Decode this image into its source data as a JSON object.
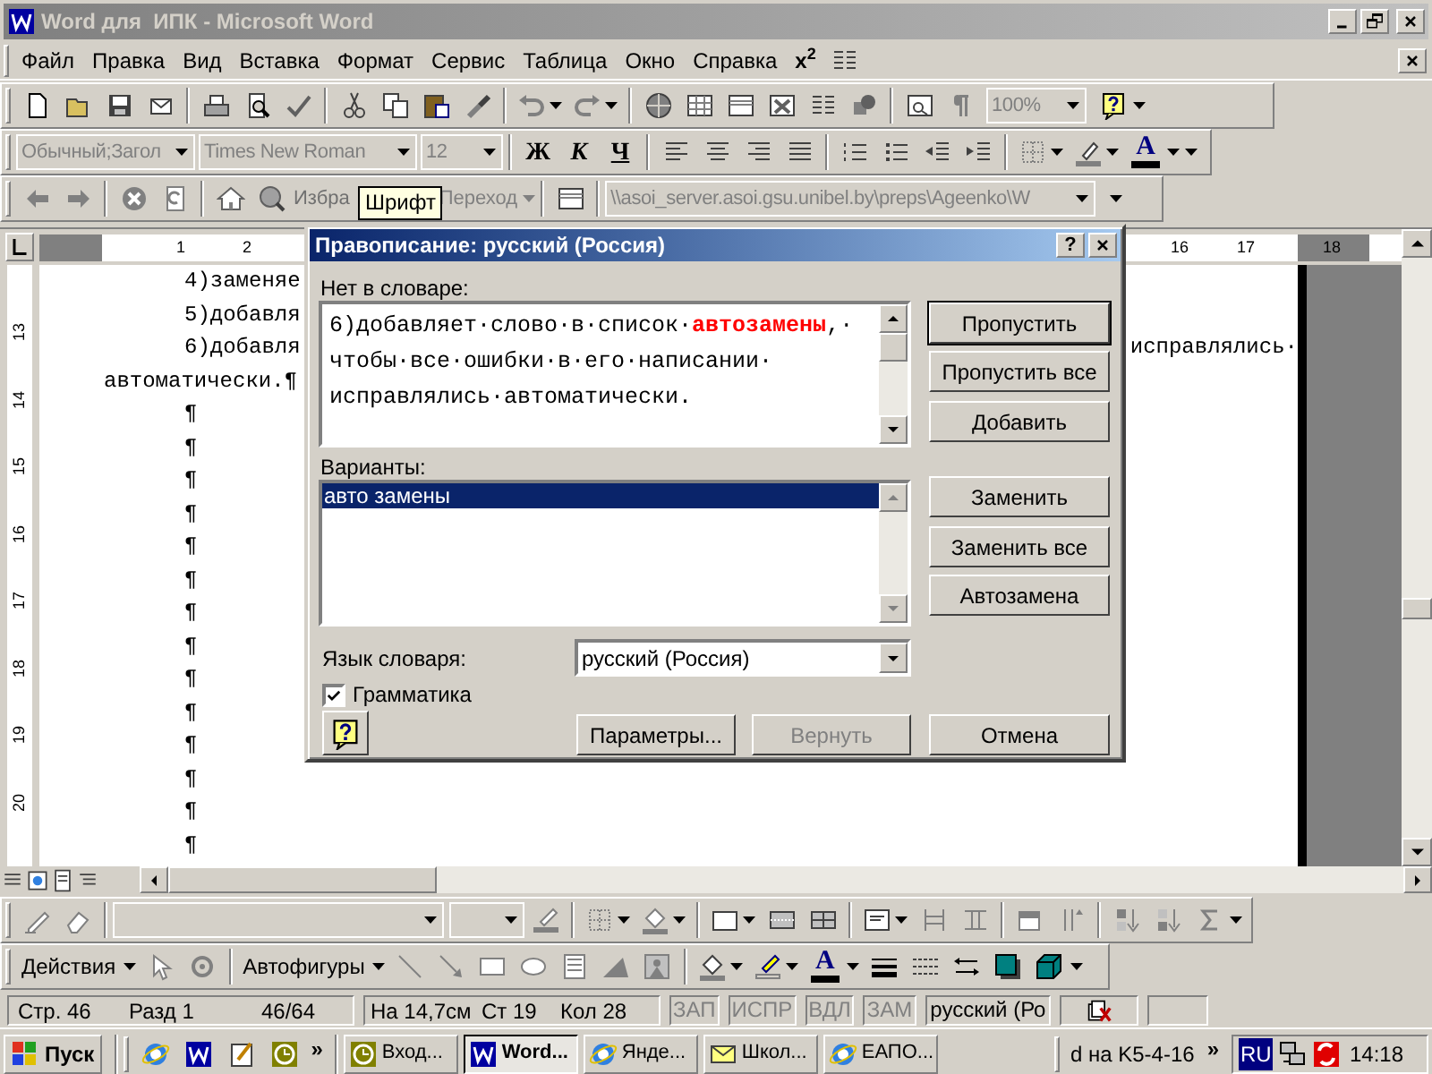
{
  "window": {
    "title": "Word для  ИПК - Microsoft Word"
  },
  "menu": {
    "items": [
      "Файл",
      "Правка",
      "Вид",
      "Вставка",
      "Формат",
      "Сервис",
      "Таблица",
      "Окно",
      "Справка"
    ],
    "superscript_button": "x$^{2}$"
  },
  "standard_toolbar": {
    "zoom": "100%"
  },
  "formatting_toolbar": {
    "style": "Обычный;Загол",
    "font": "Times New Roman",
    "size": "12",
    "bold": "Ж",
    "italic": "К",
    "underline": "Ч",
    "font_color": "A"
  },
  "web_toolbar": {
    "favorites": "Избра",
    "go": "Переход",
    "address": "\\\\asoi_server.asoi.gsu.unibel.by\\preps\\Ageenko\\W"
  },
  "tooltip": "Шрифт",
  "ruler": {
    "horizontal": [
      "1",
      "2",
      "16",
      "17",
      "18"
    ],
    "vertical": [
      "13",
      "14",
      "15",
      "16",
      "17",
      "18",
      "19",
      "20"
    ]
  },
  "document": {
    "lines": [
      {
        "kind": "indented",
        "text": "4)заменяе"
      },
      {
        "kind": "indented",
        "text": "5)добавля"
      },
      {
        "kind": "indented",
        "text": "6)добавля",
        "tail": "исправлялись·"
      },
      {
        "kind": "flush",
        "text": "автоматически.¶"
      },
      {
        "kind": "indented",
        "text": "¶"
      },
      {
        "kind": "indented",
        "text": "¶"
      },
      {
        "kind": "indented",
        "text": "¶"
      },
      {
        "kind": "indented",
        "text": "¶"
      },
      {
        "kind": "indented",
        "text": "¶"
      },
      {
        "kind": "indented",
        "text": "¶"
      },
      {
        "kind": "indented",
        "text": "¶"
      },
      {
        "kind": "indented",
        "text": "¶"
      },
      {
        "kind": "indented",
        "text": "¶"
      },
      {
        "kind": "indented",
        "text": "¶"
      },
      {
        "kind": "indented",
        "text": "¶"
      },
      {
        "kind": "indented",
        "text": "¶"
      },
      {
        "kind": "indented",
        "text": "¶"
      },
      {
        "kind": "indented",
        "text": "¶"
      }
    ]
  },
  "dialog": {
    "title": "Правописание: русский (Россия)",
    "help_button": "?",
    "not_in_dictionary_label": "Нет в словаре:",
    "sentence_lines": [
      "6)добавляет·слово·в·список·**автозамены**,·",
      "чтобы·все·ошибки·в·его·написании·",
      "исправлялись·автоматически."
    ],
    "suggestions_label": "Варианты:",
    "suggestions": [
      {
        "text": "авто замены",
        "selected": true
      }
    ],
    "language_label": "Язык словаря:",
    "language": "русский (Россия)",
    "grammar": {
      "label": "Грамматика",
      "checked": true
    },
    "side_buttons": [
      {
        "label": "Пропустить",
        "default": true
      },
      {
        "label": "Пропустить все",
        "default": false
      },
      {
        "label": "Добавить",
        "default": false
      },
      {
        "label": "Заменить",
        "default": false
      },
      {
        "label": "Заменить все",
        "default": false
      },
      {
        "label": "Автозамена",
        "default": false
      }
    ],
    "bottom_buttons": [
      {
        "label": "Параметры...",
        "disabled": false
      },
      {
        "label": "Вернуть",
        "disabled": true
      },
      {
        "label": "Отмена",
        "disabled": false
      }
    ]
  },
  "drawing_toolbar": {
    "actions": "Действия",
    "autoshapes": "Автофигуры",
    "font_color": "A"
  },
  "status_bar": {
    "page": "Стр. 46",
    "section": "Разд 1",
    "pages": "46/64",
    "at": "На 14,7см",
    "line": "Ст 19",
    "column": "Кол 28",
    "modes": [
      {
        "text": "ЗАП",
        "on": false
      },
      {
        "text": "ИСПР",
        "on": false
      },
      {
        "text": "ВДЛ",
        "on": false
      },
      {
        "text": "ЗАМ",
        "on": false
      }
    ],
    "language": "русский (Ро"
  },
  "taskbar": {
    "start": "Пуск",
    "quick_launch_more": "»",
    "tasks": [
      {
        "text": "Вход...",
        "selected": false
      },
      {
        "text": "Word...",
        "selected": true
      },
      {
        "text": "Янде...",
        "selected": false
      },
      {
        "text": "Школ...",
        "selected": false
      },
      {
        "text": "ЕАПО...",
        "selected": false
      }
    ],
    "toolbar_text": "d на K5-4-16",
    "toolbar_more": "»",
    "language": "RU",
    "time": "14:18"
  }
}
